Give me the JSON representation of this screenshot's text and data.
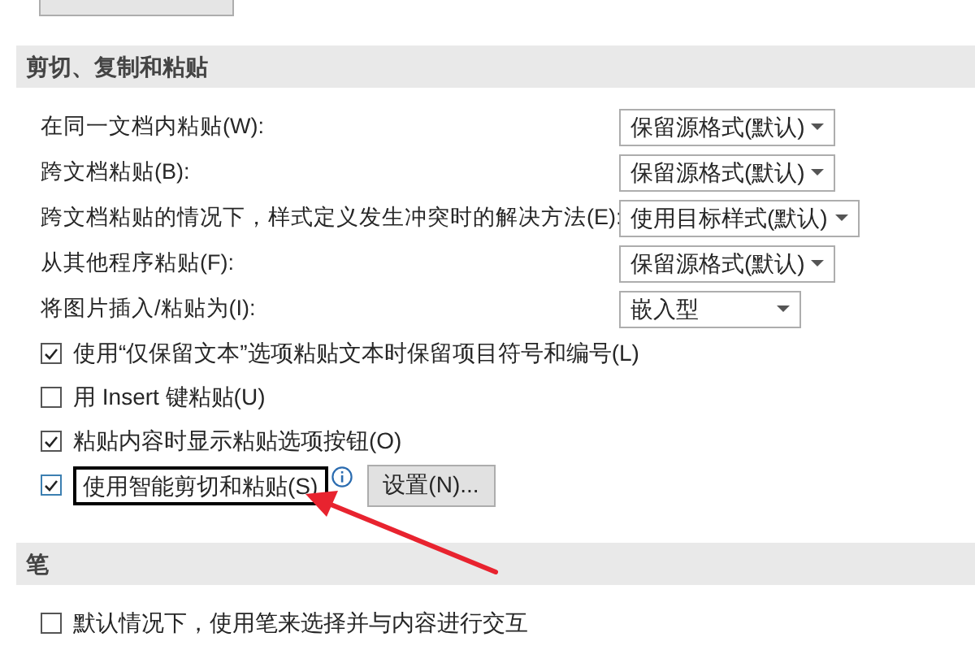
{
  "sections": [
    {
      "title": "剪切、复制和粘贴",
      "dropdown_rows": [
        {
          "label": "在同一文档内粘贴(W):",
          "value": "保留源格式(默认)",
          "kind": "normal"
        },
        {
          "label": "跨文档粘贴(B):",
          "value": "保留源格式(默认)",
          "kind": "normal"
        },
        {
          "label": "跨文档粘贴的情况下，样式定义发生冲突时的解决方法(E):",
          "value": "使用目标样式(默认)",
          "kind": "wide"
        },
        {
          "label": "从其他程序粘贴(F):",
          "value": "保留源格式(默认)",
          "kind": "normal"
        },
        {
          "label": "将图片插入/粘贴为(I):",
          "value": "嵌入型",
          "kind": "narrow"
        }
      ],
      "checkboxes": [
        {
          "label": "使用“仅保留文本”选项粘贴文本时保留项目符号和编号(L)",
          "checked": true,
          "highlighted": false
        },
        {
          "label": "用 Insert 键粘贴(U)",
          "checked": false,
          "highlighted": false
        },
        {
          "label": "粘贴内容时显示粘贴选项按钮(O)",
          "checked": true,
          "highlighted": false
        },
        {
          "label": "使用智能剪切和粘贴(S)",
          "checked": true,
          "highlighted": true,
          "info": true,
          "button": "设置(N)..."
        }
      ]
    },
    {
      "title": "笔",
      "checkboxes": [
        {
          "label": "默认情况下，使用笔来选择并与内容进行交互",
          "checked": false,
          "highlighted": false
        }
      ]
    }
  ],
  "annotation": {
    "arrow": true
  }
}
